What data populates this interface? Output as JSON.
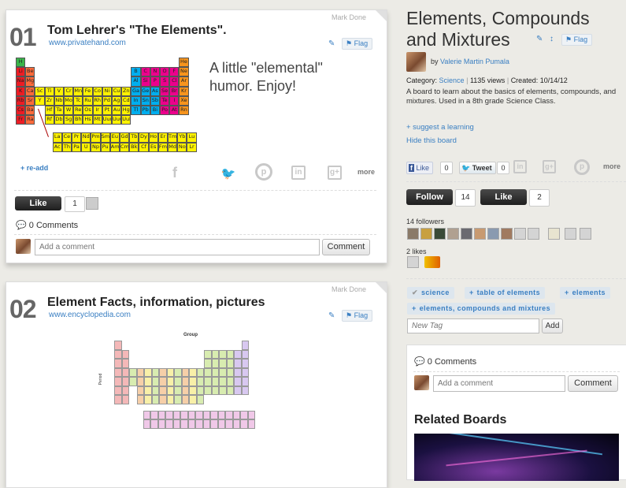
{
  "cards": [
    {
      "number": "01",
      "title": "Tom Lehrer's \"The Elements\".",
      "source": "www.privatehand.com",
      "mark_done": "Mark Done",
      "flag": "Flag",
      "caption": "A little \"elemental\" humor.  Enjoy!",
      "re_add": "+ re-add",
      "more": "more",
      "like_label": "Like",
      "like_count": "1",
      "comments": "0 Comments",
      "comment_placeholder": "Add a comment",
      "comment_button": "Comment"
    },
    {
      "number": "02",
      "title": "Element Facts, information, pictures",
      "source": "www.encyclopedia.com",
      "mark_done": "Mark Done",
      "flag": "Flag",
      "table_label": "Group",
      "period_label": "Period"
    }
  ],
  "periodic_rows": [
    [
      "H",
      "",
      "",
      "",
      "",
      "",
      "",
      "",
      "",
      "",
      "",
      "",
      "",
      "",
      "",
      "",
      "",
      "He"
    ],
    [
      "Li",
      "Be",
      "",
      "",
      "",
      "",
      "",
      "",
      "",
      "",
      "",
      "",
      "B",
      "C",
      "N",
      "O",
      "F",
      "Ne"
    ],
    [
      "Na",
      "Mg",
      "",
      "",
      "",
      "",
      "",
      "",
      "",
      "",
      "",
      "",
      "Al",
      "Si",
      "P",
      "S",
      "Cl",
      "Ar"
    ],
    [
      "K",
      "Ca",
      "Sc",
      "Ti",
      "V",
      "Cr",
      "Mn",
      "Fe",
      "Co",
      "Ni",
      "Cu",
      "Zn",
      "Ga",
      "Ge",
      "As",
      "Se",
      "Br",
      "Kr"
    ],
    [
      "Rb",
      "Sr",
      "Y",
      "Zr",
      "Nb",
      "Mo",
      "Tc",
      "Ru",
      "Rh",
      "Pd",
      "Ag",
      "Cd",
      "In",
      "Sn",
      "Sb",
      "Te",
      "I",
      "Xe"
    ],
    [
      "Cs",
      "Ba",
      "",
      "Hf",
      "Ta",
      "W",
      "Re",
      "Os",
      "Ir",
      "Pt",
      "Au",
      "Hg",
      "Tl",
      "Pb",
      "Bi",
      "Po",
      "At",
      "Rn"
    ],
    [
      "Fr",
      "Ra",
      "",
      "Rf",
      "Db",
      "Sg",
      "Bh",
      "Hs",
      "Mt",
      "Uun",
      "Uuu",
      "Uub",
      "",
      "",
      "",
      "",
      "",
      ""
    ]
  ],
  "f_rows": [
    [
      "La",
      "Ce",
      "Pr",
      "Nd",
      "Pm",
      "Sm",
      "Eu",
      "Gd",
      "Tb",
      "Dy",
      "Ho",
      "Er",
      "Tm",
      "Yb",
      "Lu"
    ],
    [
      "Ac",
      "Th",
      "Pa",
      "U",
      "Np",
      "Pu",
      "Am",
      "Cm",
      "Bk",
      "Cf",
      "Es",
      "Fm",
      "Md",
      "No",
      "Lr"
    ]
  ],
  "board": {
    "title": "Elements, Compounds and Mixtures",
    "flag": "Flag",
    "by": "by",
    "author": "Valerie Martin Pumala",
    "category_label": "Category:",
    "category": "Science",
    "views": "1135 views",
    "created": "Created: 10/14/12",
    "description": "A board to learn about the basics of elements, compounds, and mixtures. Used in a 8th grade Science Class.",
    "suggest": "+ suggest a learning",
    "hide": "Hide this board",
    "fb_like": "Like",
    "fb_count": "0",
    "tweet": "Tweet",
    "tweet_count": "0",
    "more": "more",
    "follow_label": "Follow",
    "follow_count": "14",
    "like_label": "Like",
    "like_count": "2",
    "followers_text": "14 followers",
    "likes_text": "2 likes",
    "tags": [
      {
        "label": "science",
        "kind": "check"
      },
      {
        "label": "table of elements",
        "kind": "plus"
      },
      {
        "label": "elements",
        "kind": "plus"
      },
      {
        "label": "elements, compounds and mixtures",
        "kind": "plus"
      }
    ],
    "new_tag_placeholder": "New Tag",
    "add_button": "Add",
    "comments": "0 Comments",
    "comment_placeholder": "Add a comment",
    "comment_button": "Comment",
    "related_title": "Related Boards"
  },
  "colors": {
    "link": "#3a7fc2",
    "alkali": "#ed1c24",
    "noble": "#f7941d",
    "metalloid": "#00aeef",
    "nonmetal": "#ec008c",
    "transition": "#fff200",
    "hydrogen": "#39b54a"
  }
}
